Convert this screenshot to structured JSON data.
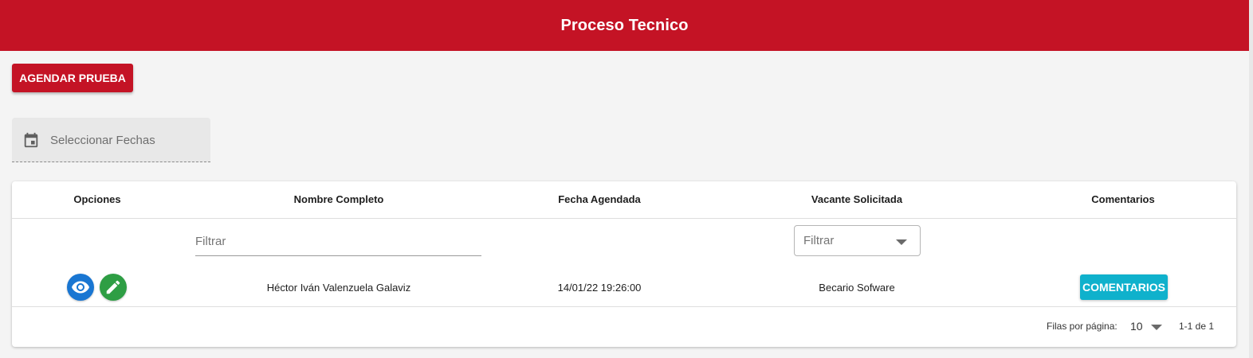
{
  "header": {
    "title": "Proceso Tecnico"
  },
  "actions": {
    "agendar_label": "AGENDAR PRUEBA"
  },
  "date_filter": {
    "placeholder": "Seleccionar Fechas",
    "icon": "calendar-icon"
  },
  "table": {
    "columns": [
      "Opciones",
      "Nombre Completo",
      "Fecha Agendada",
      "Vacante Solicitada",
      "Comentarios"
    ],
    "filters": {
      "nombre_placeholder": "Filtrar",
      "vacante_label": "Filtrar"
    },
    "rows": [
      {
        "nombre": "Héctor Iván Valenzuela Galaviz",
        "fecha": "14/01/22 19:26:00",
        "vacante": "Becario Sofware",
        "comentarios_label": "COMENTARIOS",
        "option_icons": [
          "eye-icon",
          "pencil-icon"
        ]
      }
    ],
    "pagination": {
      "rows_per_page_label": "Filas por página:",
      "rows_per_page": "10",
      "range": "1-1 de 1"
    }
  },
  "colors": {
    "brand": "#c41325",
    "view_button": "#1976d2",
    "edit_button": "#2e9e44",
    "comments_button": "#0fb1cc"
  }
}
